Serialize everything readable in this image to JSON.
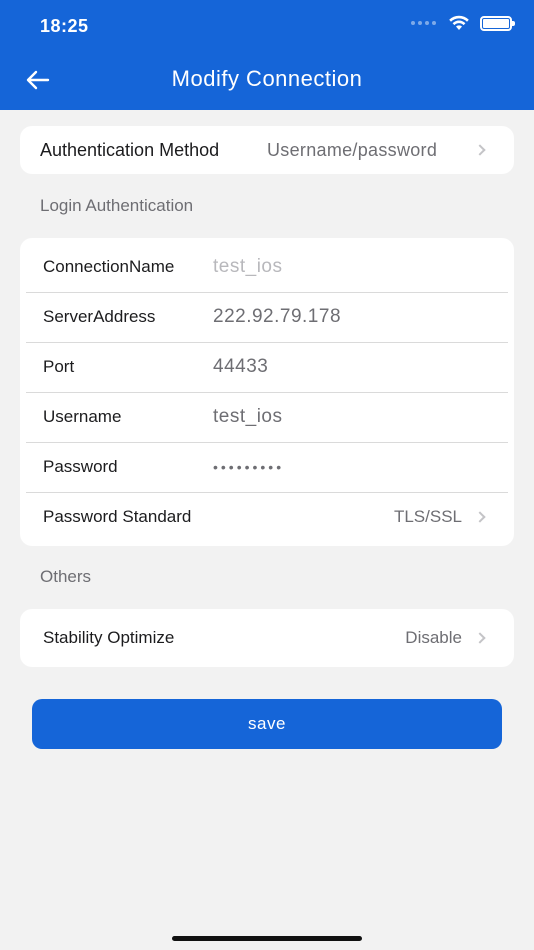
{
  "status_bar": {
    "time": "18:25"
  },
  "header": {
    "title": "Modify Connection"
  },
  "auth_method": {
    "label": "Authentication Method",
    "value": "Username/password"
  },
  "sections": {
    "login": "Login Authentication",
    "others": "Others"
  },
  "fields": {
    "connection_name": {
      "label": "ConnectionName",
      "placeholder": "test_ios"
    },
    "server_address": {
      "label": "ServerAddress",
      "value": "222.92.79.178"
    },
    "port": {
      "label": "Port",
      "value": "44433"
    },
    "username": {
      "label": "Username",
      "value": "test_ios"
    },
    "password": {
      "label": "Password",
      "value": "•••••••••"
    },
    "password_standard": {
      "label": "Password Standard",
      "value": "TLS/SSL"
    }
  },
  "stability": {
    "label": "Stability Optimize",
    "value": "Disable"
  },
  "save_button": {
    "label": "save"
  },
  "colors": {
    "accent": "#1565d8",
    "background": "#f2f2f2"
  }
}
